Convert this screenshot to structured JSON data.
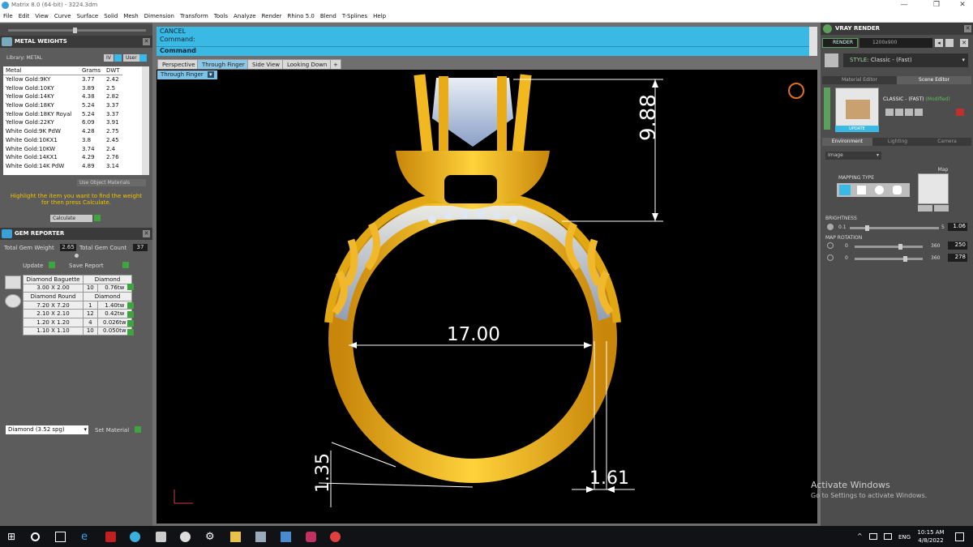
{
  "window": {
    "title": "Matrix 8.0 (64-bit) - 3224.3dm",
    "minimize": "—",
    "maximize": "❐",
    "close": "✕"
  },
  "menu": [
    "File",
    "Edit",
    "View",
    "Curve",
    "Surface",
    "Solid",
    "Mesh",
    "Dimension",
    "Transform",
    "Tools",
    "Analyze",
    "Render",
    "Rhino 5.0",
    "Blend",
    "T-Splines",
    "Help"
  ],
  "metal_weights": {
    "title": "METAL WEIGHTS",
    "library_label": "Library: METAL",
    "library_btn1": "IV",
    "library_btn2": "User",
    "columns": [
      "Metal",
      "Grams",
      "DWT"
    ],
    "rows": [
      [
        "Yellow Gold:9KY",
        "3.77",
        "2.42"
      ],
      [
        "Yellow Gold:10KY",
        "3.89",
        "2.5"
      ],
      [
        "Yellow Gold:14KY",
        "4.38",
        "2.82"
      ],
      [
        "Yellow Gold:18KY",
        "5.24",
        "3.37"
      ],
      [
        "Yellow Gold:18KY Royal",
        "5.24",
        "3.37"
      ],
      [
        "Yellow Gold:22KY",
        "6.09",
        "3.91"
      ],
      [
        "White Gold:9K PdW",
        "4.28",
        "2.75"
      ],
      [
        "White Gold:10KX1",
        "3.8",
        "2.45"
      ],
      [
        "White Gold:10KW",
        "3.74",
        "2.4"
      ],
      [
        "White Gold:14KX1",
        "4.29",
        "2.76"
      ],
      [
        "White Gold:14K PdW",
        "4.89",
        "3.14"
      ]
    ],
    "use_object_materials": "Use Object Materials",
    "hint": "Highlight the item you want to find the weight for then press Calculate.",
    "calculate": "Calculate"
  },
  "gem_reporter": {
    "title": "GEM REPORTER",
    "total_weight_label": "Total Gem Weight",
    "total_weight": "2.65",
    "total_count_label": "Total Gem Count",
    "total_count": "37",
    "update": "Update",
    "save_report": "Save Report",
    "groups": [
      {
        "name": "Diamond Baguette",
        "material": "Diamond",
        "rows": [
          [
            "3.00 X 2.00",
            "10",
            "0.76tw"
          ]
        ]
      },
      {
        "name": "Diamond Round",
        "material": "Diamond",
        "rows": [
          [
            "7.20 X 7.20",
            "1",
            "1.40tw"
          ],
          [
            "2.10 X 2.10",
            "12",
            "0.42tw"
          ],
          [
            "1.20 X 1.20",
            "4",
            "0.026tw"
          ],
          [
            "1.10 X 1.10",
            "10",
            "0.050tw"
          ]
        ]
      }
    ],
    "material_select": "Diamond    (3.52 spg)",
    "set_material": "Set Material"
  },
  "command": {
    "cancel": "CANCEL",
    "line1": "Command:",
    "prompt": "Command:"
  },
  "viewport_tabs": [
    "Perspective",
    "Through Finger",
    "Side View",
    "Looking Down"
  ],
  "active_tab": "Through Finger",
  "viewport_label": "Through Finger",
  "dimensions": {
    "height": "9.88",
    "inner_diameter": "17.00",
    "band_thickness": "1.35",
    "band_width": "1.61"
  },
  "vray": {
    "title": "VRAY RENDER",
    "render_btn": "RENDER",
    "resolution": "1200x900",
    "style_label": "STYLE:",
    "style_value": "Classic - (Fast)",
    "tabs": [
      "Material Editor",
      "Scene Editor"
    ],
    "scene_name": "CLASSIC - (FAST)",
    "scene_modified": "(Modified)",
    "update": "UPDATE",
    "sub_tabs": [
      "Environment",
      "Lighting",
      "Camera"
    ],
    "env_select": "Image",
    "mapping_type": "MAPPING TYPE",
    "map_label": "Map",
    "brightness_label": "BRIGHTNESS",
    "brightness_min": "0.1",
    "brightness_max": "5",
    "brightness": "1.06",
    "map_rotation_label": "MAP ROTATION",
    "rot1_min": "0",
    "rot1_max": "360",
    "rot1": "250",
    "rot2_min": "0",
    "rot2_max": "360",
    "rot2": "278"
  },
  "watermark": {
    "title": "Activate Windows",
    "sub": "Go to Settings to activate Windows."
  },
  "taskbar": {
    "time": "10:15 AM",
    "date": "4/8/2022",
    "lang": "ENG"
  }
}
